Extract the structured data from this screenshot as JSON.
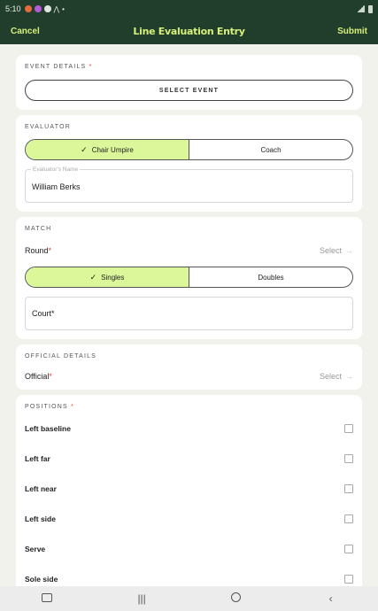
{
  "status": {
    "time": "5:10"
  },
  "appbar": {
    "cancel": "Cancel",
    "title": "Line Evaluation Entry",
    "submit": "Submit"
  },
  "event": {
    "label": "EVENT DETAILS",
    "required": "*",
    "button": "SELECT EVENT"
  },
  "evaluator": {
    "label": "EVALUATOR",
    "options": [
      "Chair Umpire",
      "Coach"
    ],
    "selected": "Chair Umpire",
    "name_label": "Evaluator's Name",
    "name_value": "William Berks"
  },
  "match": {
    "label": "MATCH",
    "round_label": "Round",
    "required": "*",
    "round_value": "Select",
    "types": [
      "Singles",
      "Doubles"
    ],
    "selected": "Singles",
    "court_placeholder": "Court*"
  },
  "official": {
    "label": "OFFICIAL DETAILS",
    "field_label": "Official",
    "required": "*",
    "field_value": "Select"
  },
  "positions": {
    "label": "POSITIONS",
    "required": "*",
    "items": [
      "Left baseline",
      "Left far",
      "Left near",
      "Left side",
      "Serve",
      "Sole side"
    ]
  },
  "icons": {
    "check": "check-icon",
    "arrow": "arrow-right-icon"
  },
  "colors": {
    "primary": "#213d2b",
    "accent": "#d6f07a",
    "selected_bg": "#dcf79a",
    "required": "#e0443a"
  }
}
